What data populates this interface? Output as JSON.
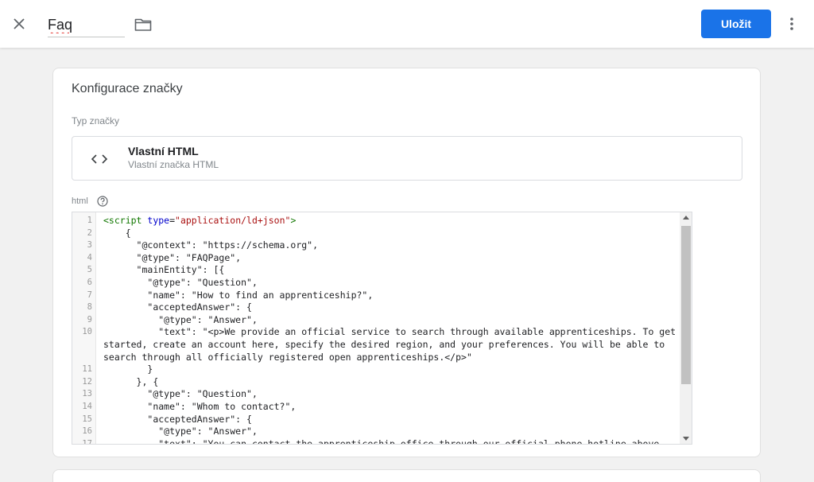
{
  "header": {
    "tag_name": "Faq",
    "save_label": "Uložit"
  },
  "config": {
    "title": "Konfigurace značky",
    "tag_type_label": "Typ značky",
    "tag_type": {
      "title": "Vlastní HTML",
      "subtitle": "Vlastní značka HTML"
    },
    "html_label": "html"
  },
  "editor": {
    "lines": [
      {
        "n": "1",
        "segments": [
          [
            "tag",
            "<script "
          ],
          [
            "attr",
            "type"
          ],
          [
            "text",
            "="
          ],
          [
            "str",
            "\"application/ld+json\""
          ],
          [
            "tag",
            ">"
          ]
        ]
      },
      {
        "n": "2",
        "segments": [
          [
            "text",
            "    {"
          ]
        ]
      },
      {
        "n": "3",
        "segments": [
          [
            "text",
            "      \"@context\": \"https://schema.org\","
          ]
        ]
      },
      {
        "n": "4",
        "segments": [
          [
            "text",
            "      \"@type\": \"FAQPage\","
          ]
        ]
      },
      {
        "n": "5",
        "segments": [
          [
            "text",
            "      \"mainEntity\": [{"
          ]
        ]
      },
      {
        "n": "6",
        "segments": [
          [
            "text",
            "        \"@type\": \"Question\","
          ]
        ]
      },
      {
        "n": "7",
        "segments": [
          [
            "text",
            "        \"name\": \"How to find an apprenticeship?\","
          ]
        ]
      },
      {
        "n": "8",
        "segments": [
          [
            "text",
            "        \"acceptedAnswer\": {"
          ]
        ]
      },
      {
        "n": "9",
        "segments": [
          [
            "text",
            "          \"@type\": \"Answer\","
          ]
        ]
      },
      {
        "n": "10",
        "segments": [
          [
            "text",
            "          \"text\": \"<p>We provide an official service to search through available apprenticeships. To get started, create an account here, specify the desired region, and your preferences. You will be able to search through all officially registered open apprenticeships.</p>\""
          ]
        ]
      },
      {
        "n": "11",
        "segments": [
          [
            "text",
            "        }"
          ]
        ]
      },
      {
        "n": "12",
        "segments": [
          [
            "text",
            "      }, {"
          ]
        ]
      },
      {
        "n": "13",
        "segments": [
          [
            "text",
            "        \"@type\": \"Question\","
          ]
        ]
      },
      {
        "n": "14",
        "segments": [
          [
            "text",
            "        \"name\": \"Whom to contact?\","
          ]
        ]
      },
      {
        "n": "15",
        "segments": [
          [
            "text",
            "        \"acceptedAnswer\": {"
          ]
        ]
      },
      {
        "n": "16",
        "segments": [
          [
            "text",
            "          \"@type\": \"Answer\","
          ]
        ]
      },
      {
        "n": "17",
        "segments": [
          [
            "text",
            "          \"text\": \"You can contact the apprenticeship office through our official phone hotline above, or"
          ]
        ]
      }
    ]
  }
}
